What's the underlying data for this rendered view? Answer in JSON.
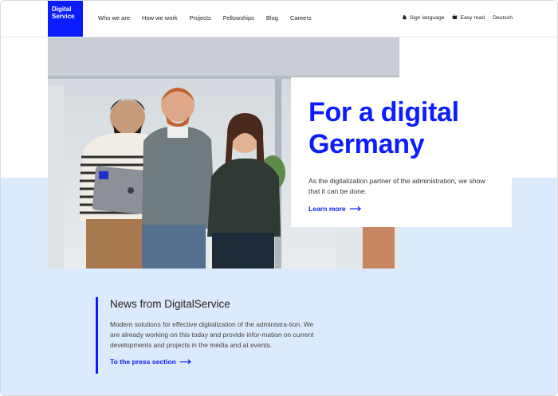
{
  "brand": {
    "logo_line1": "Digital",
    "logo_line2": "Service",
    "accent": "#0b1dfd",
    "light_blue": "#dbeafc"
  },
  "nav": {
    "items": [
      "Who we are",
      "How we work",
      "Projects",
      "Fellowships",
      "Blog",
      "Careers"
    ]
  },
  "utility": {
    "sign_language": "Sign language",
    "easy_read": "Easy read",
    "language": "Deutsch",
    "sign_language_icon": "hand-icon",
    "easy_read_icon": "book-icon"
  },
  "hero": {
    "title_line1": "For a digital",
    "title_line2": "Germany",
    "text": "As the digitalization partner of the administration, we show that it can be done.",
    "link": "Learn more",
    "link_icon": "arrow-right-icon"
  },
  "news": {
    "title": "News from DigitalService",
    "text": "Modern solutions for effective digitalization of the administra-tion. We are already working on this today and provide infor-mation on current developments and projects in the media and at events.",
    "link": "To the press section",
    "link_icon": "arrow-right-icon"
  }
}
